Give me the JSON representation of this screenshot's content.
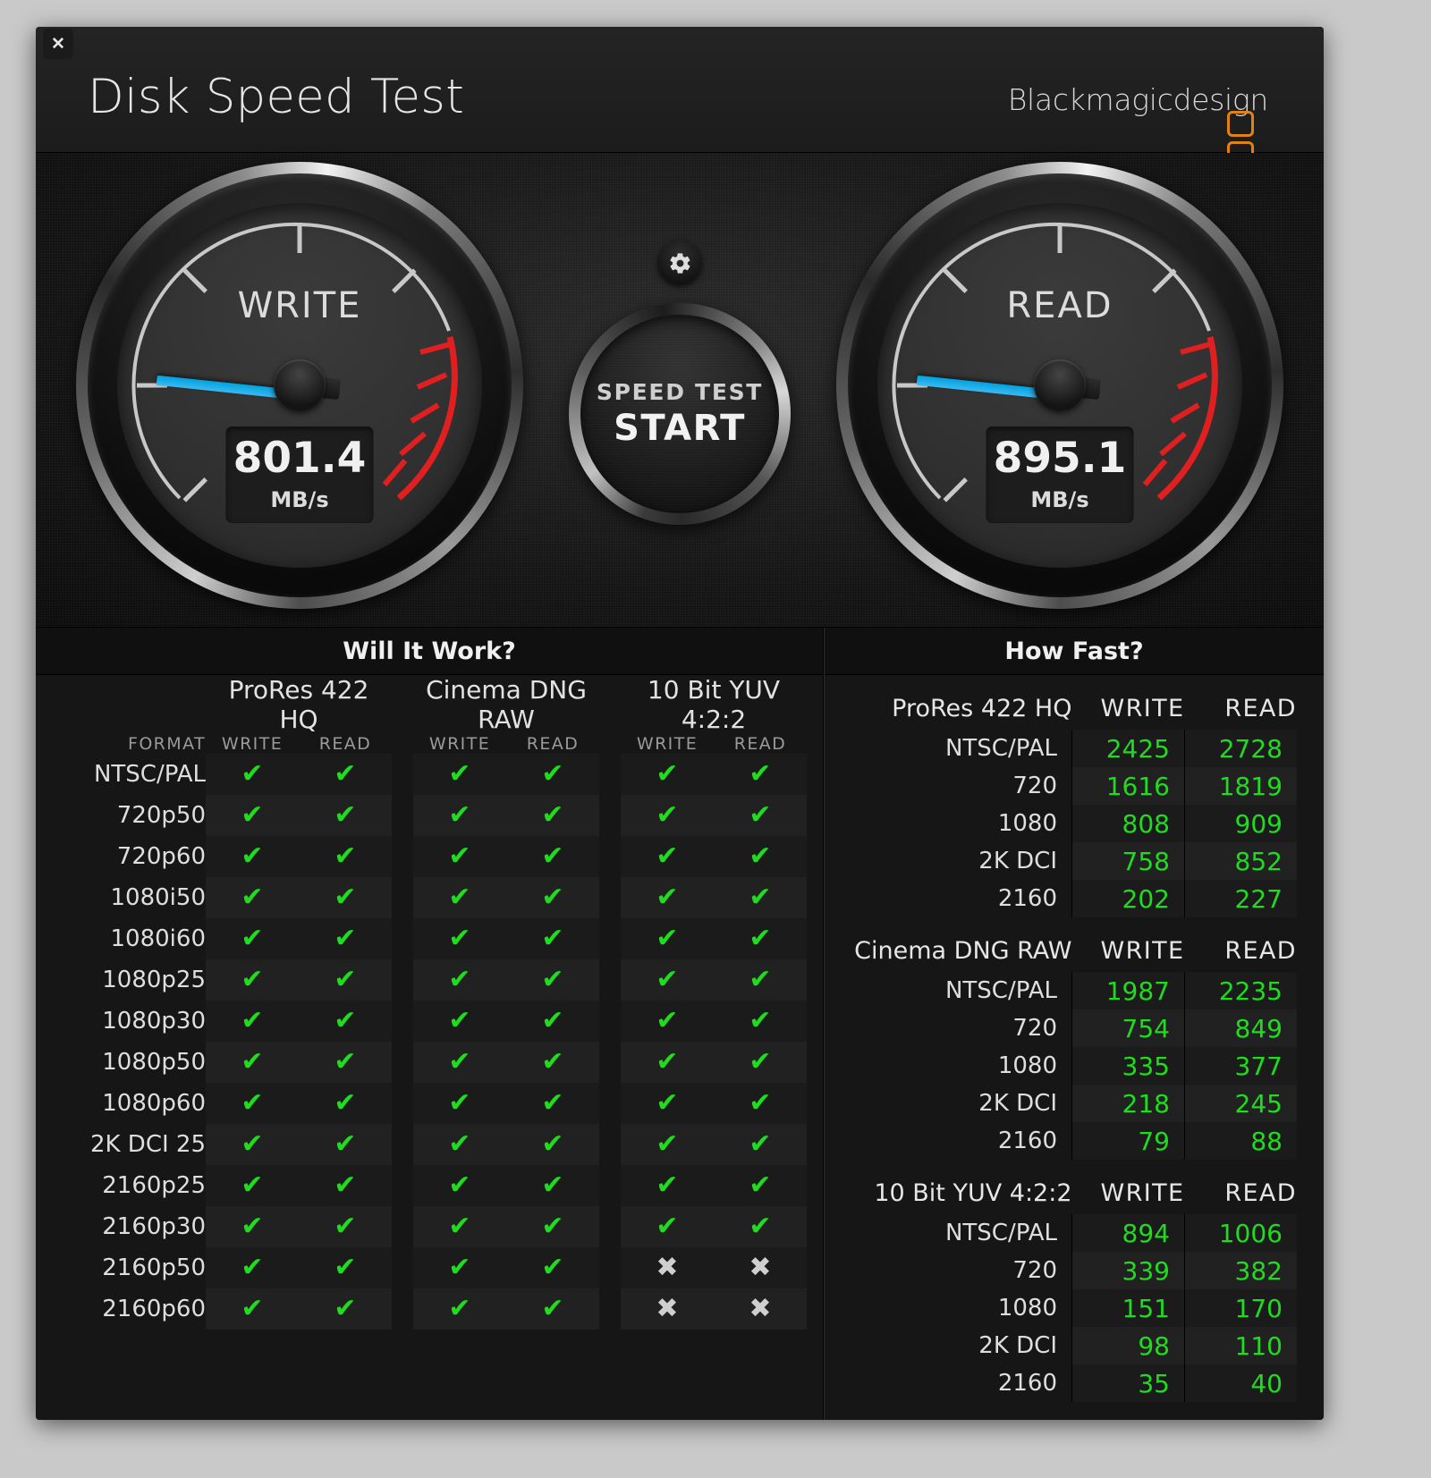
{
  "window": {
    "close_label": "✕",
    "title": "Disk Speed Test",
    "brand": "Blackmagicdesign"
  },
  "gauges": {
    "write": {
      "label": "WRITE",
      "value": "801.4",
      "unit": "MB/s",
      "needle_angle": 186
    },
    "read": {
      "label": "READ",
      "value": "895.1",
      "unit": "MB/s",
      "needle_angle": 186
    }
  },
  "controls": {
    "gear_icon": "gear-icon",
    "start_line1": "SPEED TEST",
    "start_line2": "START"
  },
  "will_it_work": {
    "heading": "Will It Work?",
    "format_header": "FORMAT",
    "groups": [
      "ProRes 422 HQ",
      "Cinema DNG RAW",
      "10 Bit YUV 4:2:2"
    ],
    "sub_headers": [
      "WRITE",
      "READ"
    ],
    "ok_glyph": "✔",
    "no_glyph": "✖",
    "rows": [
      {
        "format": "NTSC/PAL",
        "marks": [
          true,
          true,
          true,
          true,
          true,
          true
        ]
      },
      {
        "format": "720p50",
        "marks": [
          true,
          true,
          true,
          true,
          true,
          true
        ]
      },
      {
        "format": "720p60",
        "marks": [
          true,
          true,
          true,
          true,
          true,
          true
        ]
      },
      {
        "format": "1080i50",
        "marks": [
          true,
          true,
          true,
          true,
          true,
          true
        ]
      },
      {
        "format": "1080i60",
        "marks": [
          true,
          true,
          true,
          true,
          true,
          true
        ]
      },
      {
        "format": "1080p25",
        "marks": [
          true,
          true,
          true,
          true,
          true,
          true
        ]
      },
      {
        "format": "1080p30",
        "marks": [
          true,
          true,
          true,
          true,
          true,
          true
        ]
      },
      {
        "format": "1080p50",
        "marks": [
          true,
          true,
          true,
          true,
          true,
          true
        ]
      },
      {
        "format": "1080p60",
        "marks": [
          true,
          true,
          true,
          true,
          true,
          true
        ]
      },
      {
        "format": "2K DCI 25",
        "marks": [
          true,
          true,
          true,
          true,
          true,
          true
        ]
      },
      {
        "format": "2160p25",
        "marks": [
          true,
          true,
          true,
          true,
          true,
          true
        ]
      },
      {
        "format": "2160p30",
        "marks": [
          true,
          true,
          true,
          true,
          true,
          true
        ]
      },
      {
        "format": "2160p50",
        "marks": [
          true,
          true,
          true,
          true,
          false,
          false
        ]
      },
      {
        "format": "2160p60",
        "marks": [
          true,
          true,
          true,
          true,
          false,
          false
        ]
      }
    ]
  },
  "how_fast": {
    "heading": "How Fast?",
    "col_write": "WRITE",
    "col_read": "READ",
    "sections": [
      {
        "title": "ProRes 422 HQ",
        "rows": [
          {
            "format": "NTSC/PAL",
            "write": "2425",
            "read": "2728"
          },
          {
            "format": "720",
            "write": "1616",
            "read": "1819"
          },
          {
            "format": "1080",
            "write": "808",
            "read": "909"
          },
          {
            "format": "2K DCI",
            "write": "758",
            "read": "852"
          },
          {
            "format": "2160",
            "write": "202",
            "read": "227"
          }
        ]
      },
      {
        "title": "Cinema DNG RAW",
        "rows": [
          {
            "format": "NTSC/PAL",
            "write": "1987",
            "read": "2235"
          },
          {
            "format": "720",
            "write": "754",
            "read": "849"
          },
          {
            "format": "1080",
            "write": "335",
            "read": "377"
          },
          {
            "format": "2K DCI",
            "write": "218",
            "read": "245"
          },
          {
            "format": "2160",
            "write": "79",
            "read": "88"
          }
        ]
      },
      {
        "title": "10 Bit YUV 4:2:2",
        "rows": [
          {
            "format": "NTSC/PAL",
            "write": "894",
            "read": "1006"
          },
          {
            "format": "720",
            "write": "339",
            "read": "382"
          },
          {
            "format": "1080",
            "write": "151",
            "read": "170"
          },
          {
            "format": "2K DCI",
            "write": "98",
            "read": "110"
          },
          {
            "format": "2160",
            "write": "35",
            "read": "40"
          }
        ]
      }
    ]
  },
  "colors": {
    "ok_green": "#1fdc1f",
    "needle_blue": "#00a2e0",
    "brand_orange": "#e08214",
    "redzone": "#e02020"
  }
}
